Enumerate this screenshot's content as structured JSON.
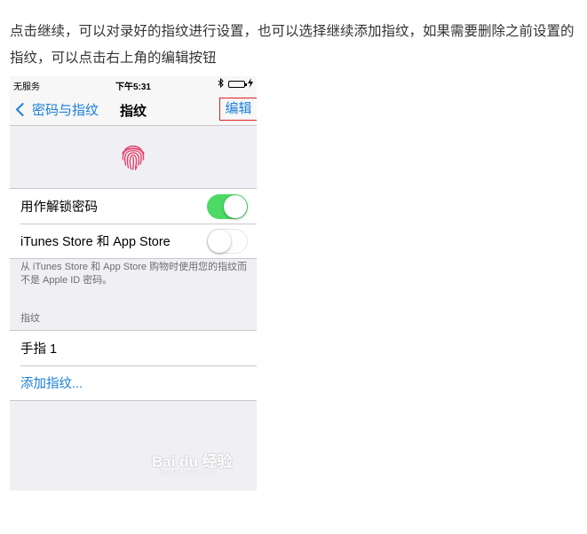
{
  "article": {
    "text": "点击继续，可以对录好的指纹进行设置，也可以选择继续添加指纹，如果需要删除之前设置的指纹，可以点击右上角的编辑按钮"
  },
  "status_bar": {
    "carrier": "无服务",
    "time": "下午5:31",
    "battery_color": "#4cd964"
  },
  "nav": {
    "back_label": "密码与指纹",
    "title": "指纹",
    "edit_label": "编辑",
    "accent_color": "#1a7fd8",
    "highlight_color": "#e02020"
  },
  "fingerprint": {
    "icon": "fingerprint-icon",
    "color": "#e5426a"
  },
  "toggles": [
    {
      "label": "用作解锁密码",
      "state": "on"
    },
    {
      "label": "iTunes Store 和 App Store",
      "state": "off"
    }
  ],
  "footnote": "从 iTunes Store 和 App Store 购物时使用您的指纹而不是 Apple ID 密码。",
  "fingerprints_section": {
    "header": "指纹",
    "items": [
      "手指 1"
    ],
    "add_label": "添加指纹..."
  },
  "watermark": {
    "text": "Bai du 经验",
    "subtext": "jingyan.baidu.com"
  }
}
